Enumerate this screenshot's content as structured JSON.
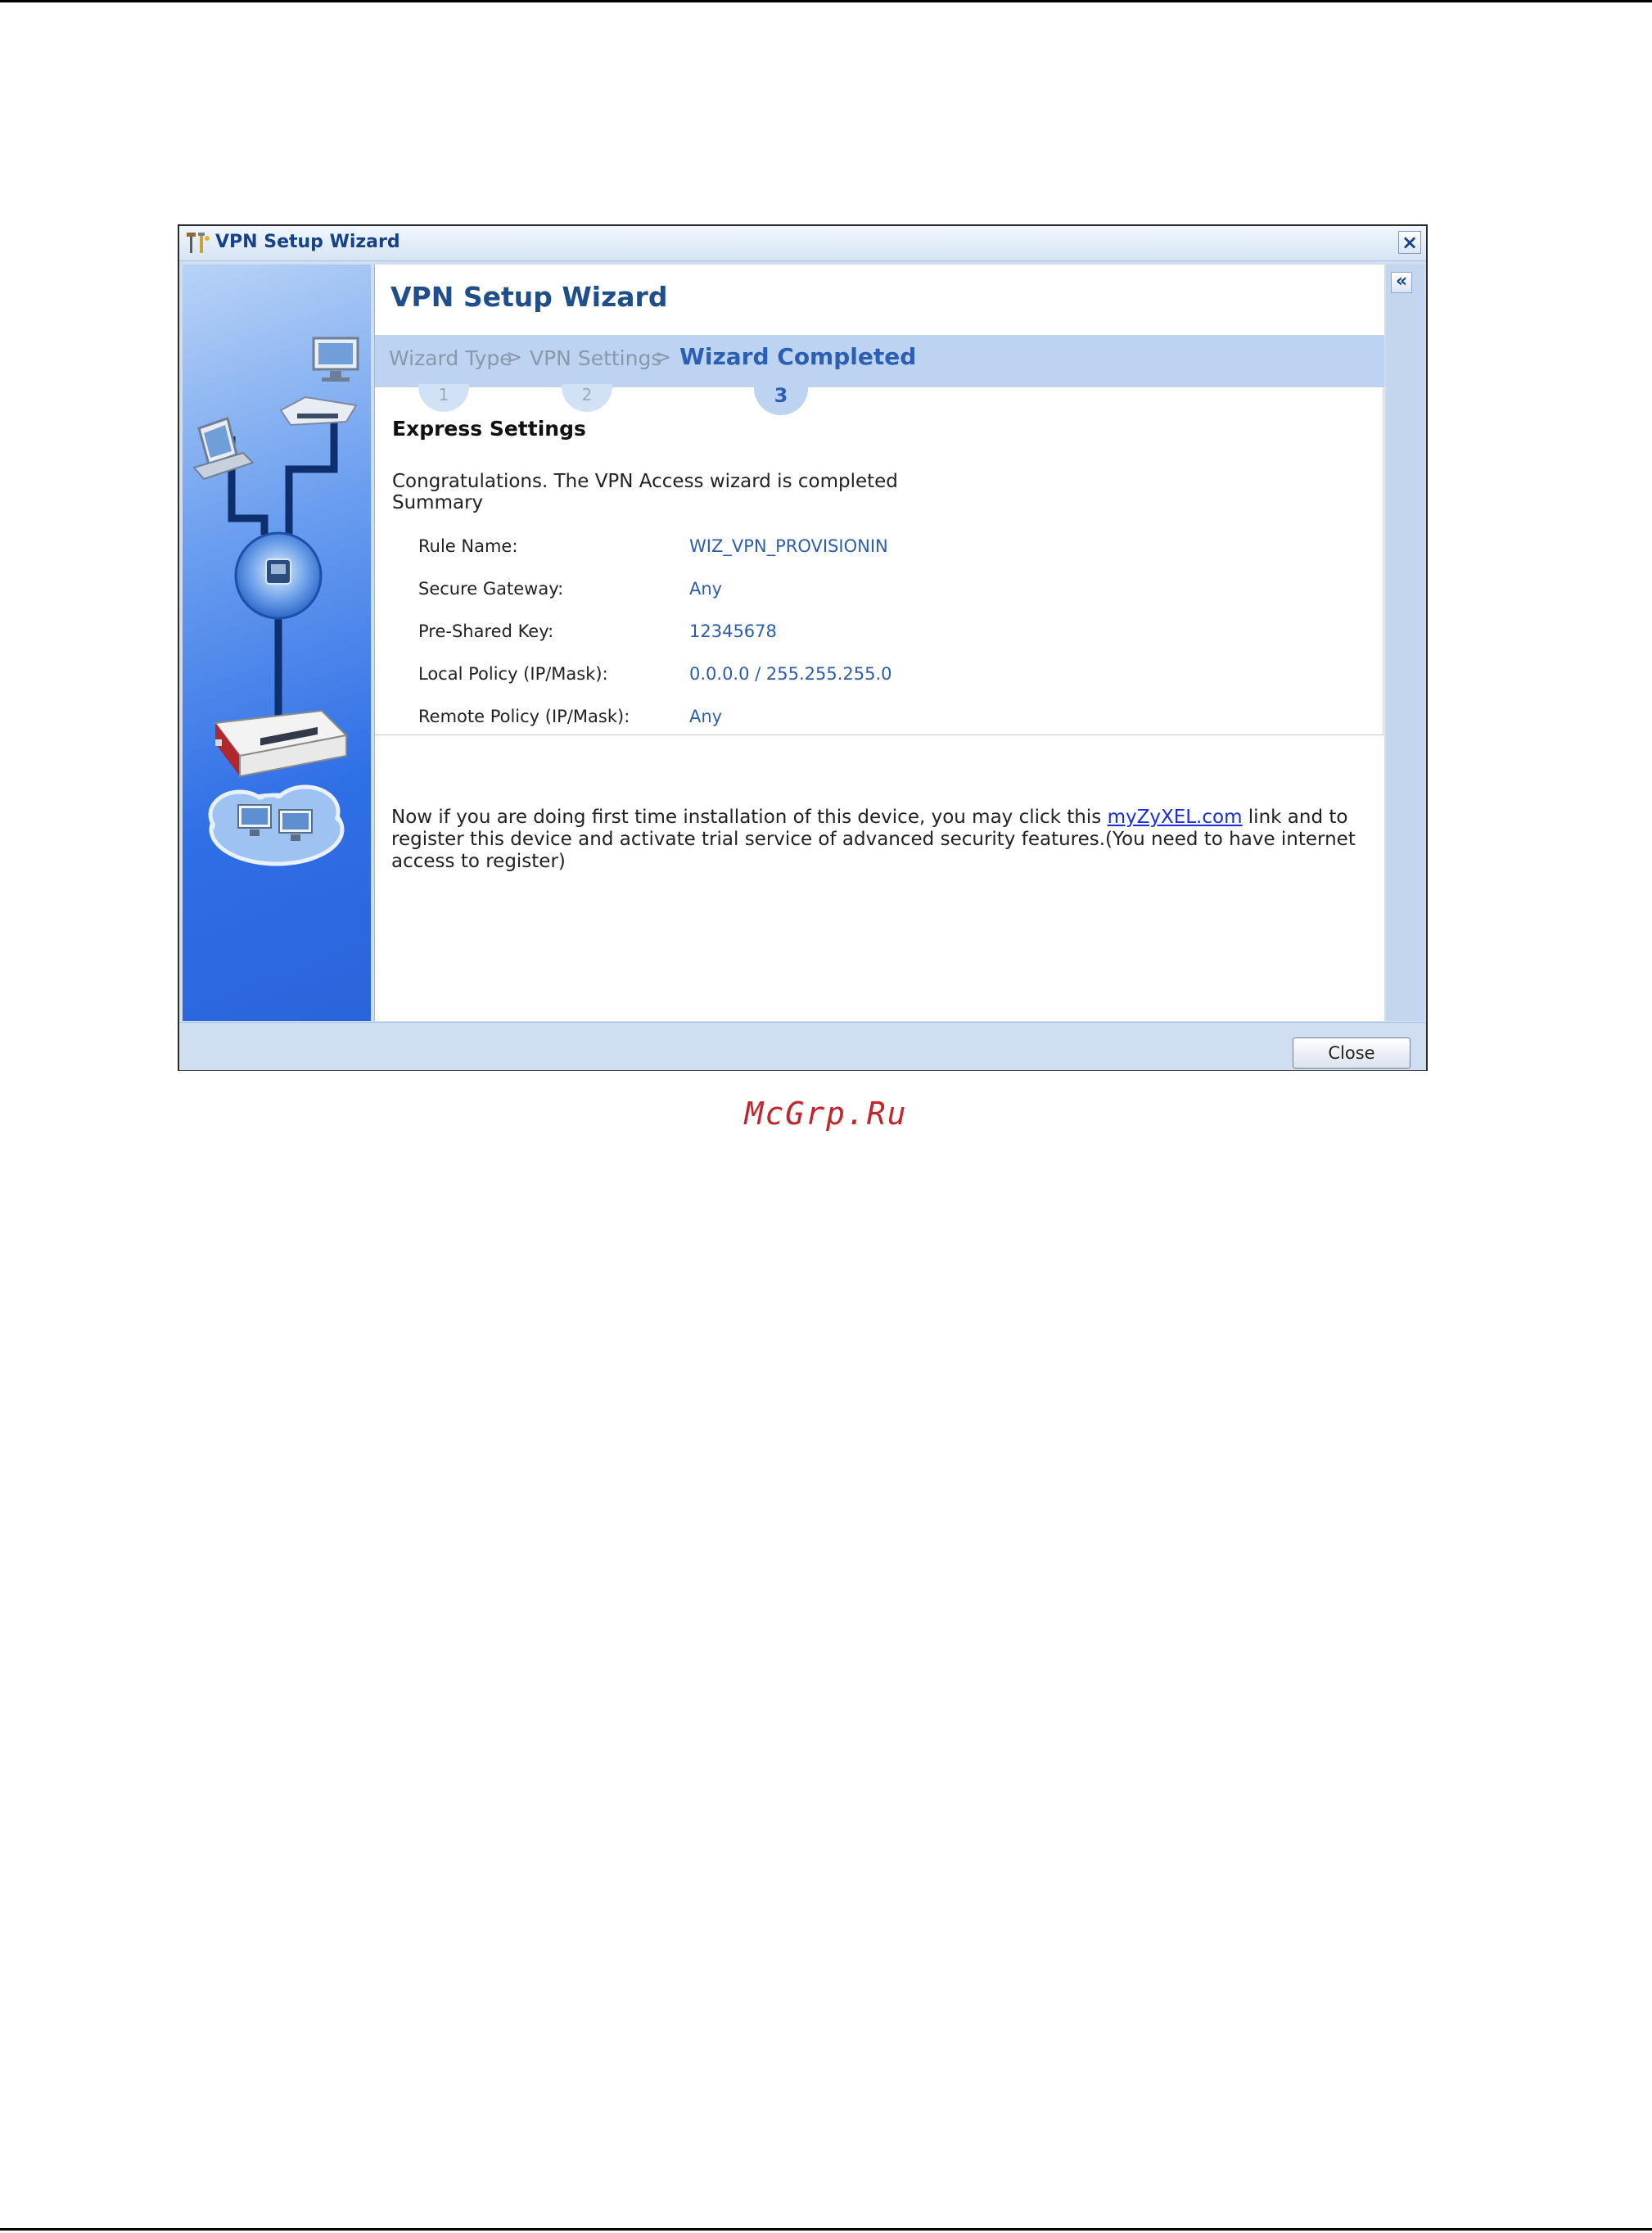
{
  "window": {
    "title": "VPN Setup Wizard"
  },
  "wizard": {
    "heading": "VPN Setup Wizard",
    "steps": [
      {
        "label": "Wizard Type",
        "number": "1"
      },
      {
        "label": "VPN Settings",
        "number": "2"
      },
      {
        "label": "Wizard Completed",
        "number": "3"
      }
    ],
    "step_separator": ">"
  },
  "summary": {
    "section_title": "Express Settings",
    "message": "Congratulations. The VPN Access wizard is completed",
    "summary_label": "Summary",
    "rows": [
      {
        "label": "Rule Name:",
        "value": "WIZ_VPN_PROVISIONIN"
      },
      {
        "label": "Secure Gateway:",
        "value": "Any"
      },
      {
        "label": "Pre-Shared Key:",
        "value": "12345678"
      },
      {
        "label": "Local Policy (IP/Mask):",
        "value": "0.0.0.0 / 255.255.255.0"
      },
      {
        "label": "Remote Policy (IP/Mask):",
        "value": "Any"
      }
    ]
  },
  "note": {
    "before_link": "Now if you are doing first time installation of this device, you may click this ",
    "link_text": "myZyXEL.com",
    "after_link": " link and to register this device and activate trial service of advanced security features.(You need to have internet access to register)"
  },
  "footer": {
    "close_label": "Close"
  },
  "watermark": "McGrp.Ru",
  "colors": {
    "title_blue": "#15428b",
    "heading_blue": "#1f4e8c",
    "steps_bar": "#bcd4f2",
    "value_blue": "#2e5da8",
    "link_blue": "#1a2fd6",
    "watermark_red": "#c0262c"
  },
  "icons": {
    "title_icon": "wizard-tools-icon",
    "close_icon": "close-icon",
    "collapse_icon": "double-chevron-left-icon"
  }
}
